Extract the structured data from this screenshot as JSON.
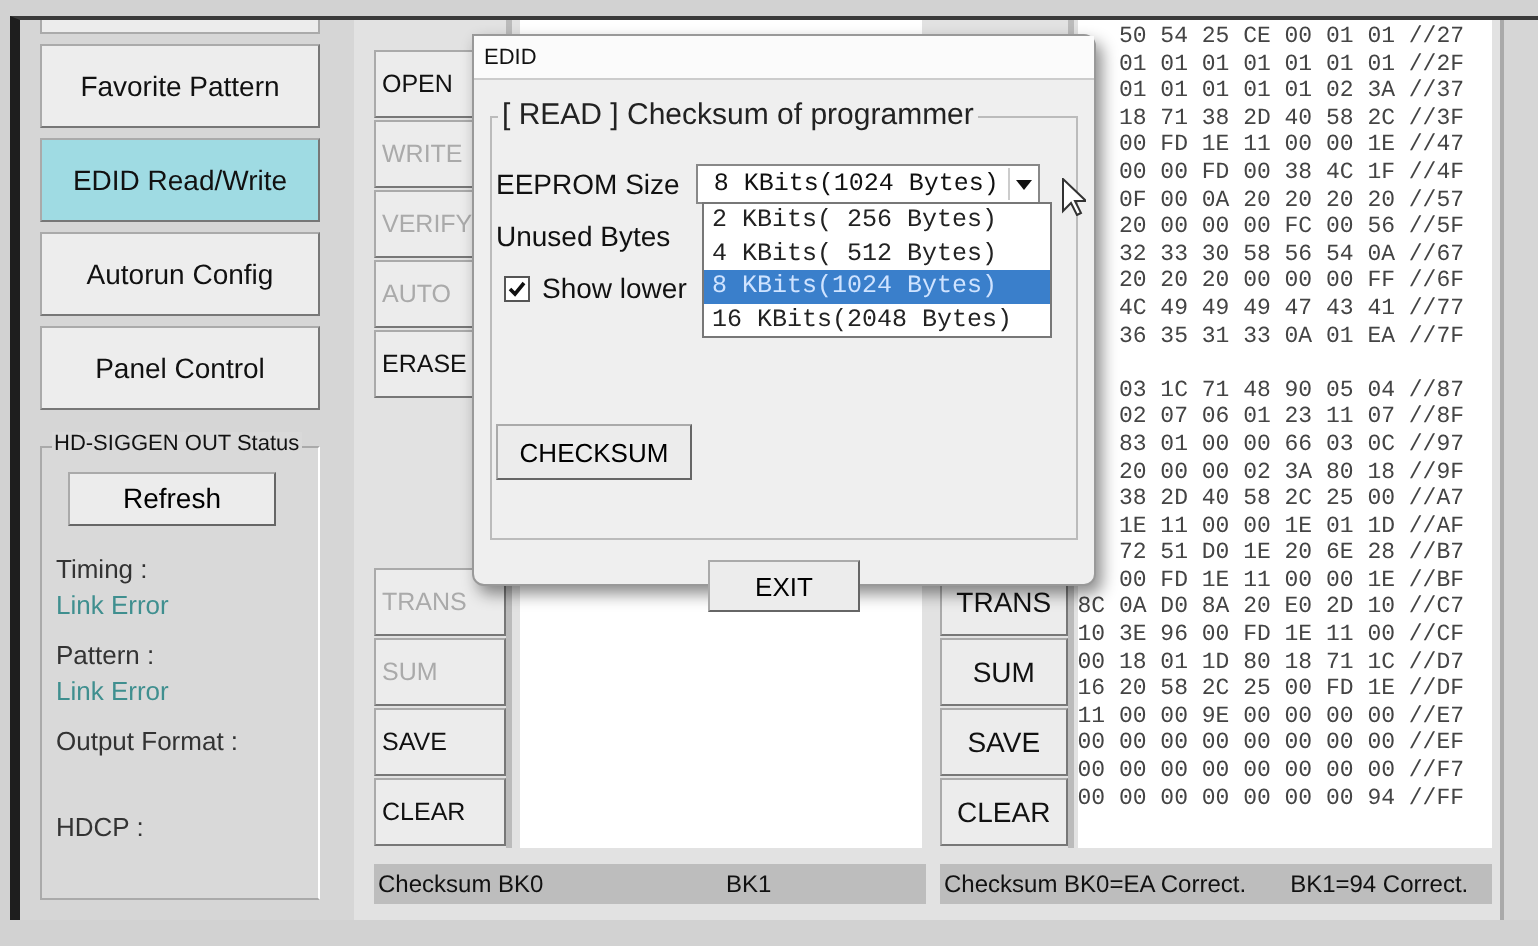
{
  "nav": {
    "items": [
      {
        "label": "Favorite Pattern",
        "selected": false
      },
      {
        "label": "EDID Read/Write",
        "selected": true
      },
      {
        "label": "Autorun Config",
        "selected": false
      },
      {
        "label": "Panel Control",
        "selected": false
      }
    ]
  },
  "status_group": {
    "title": "HD-SIGGEN OUT Status",
    "refresh": "Refresh",
    "fields": [
      {
        "label": "Timing :",
        "value": "Link Error"
      },
      {
        "label": "Pattern :",
        "value": "Link Error"
      },
      {
        "label": "Output Format :"
      },
      {
        "label": "HDCP :"
      }
    ]
  },
  "left_panel": {
    "top_buttons": [
      {
        "label": "OPEN",
        "disabled": false
      },
      {
        "label": "WRITE",
        "disabled": true
      },
      {
        "label": "VERIFY",
        "disabled": true
      },
      {
        "label": "AUTO",
        "disabled": true
      },
      {
        "label": "ERASE",
        "disabled": false
      }
    ],
    "bottom_buttons": [
      {
        "label": "TRANS",
        "disabled": true
      },
      {
        "label": "SUM",
        "disabled": true
      },
      {
        "label": "SAVE",
        "disabled": false
      },
      {
        "label": "CLEAR",
        "disabled": false
      }
    ],
    "status": [
      "Checksum BK0",
      "BK1"
    ]
  },
  "right_panel": {
    "buttons": [
      {
        "label": "TRANS",
        "disabled": false
      },
      {
        "label": "SUM",
        "disabled": false
      },
      {
        "label": "SAVE",
        "disabled": false
      },
      {
        "label": "CLEAR",
        "disabled": false
      }
    ],
    "hex_blocks": [
      [
        "50 54 25 CE 00 01 01 //27",
        "01 01 01 01 01 01 01 //2F",
        "01 01 01 01 01 02 3A //37",
        "18 71 38 2D 40 58 2C //3F",
        "00 FD 1E 11 00 00 1E //47",
        "00 00 FD 00 38 4C 1F //4F",
        "0F 00 0A 20 20 20 20 //57",
        "20 00 00 00 FC 00 56 //5F",
        "32 33 30 58 56 54 0A //67",
        "20 20 20 00 00 00 FF //6F",
        "4C 49 49 49 47 43 41 //77",
        "36 35 31 33 0A 01 EA //7F"
      ],
      [
        "03 1C 71 48 90 05 04 //87",
        "02 07 06 01 23 11 07 //8F",
        "83 01 00 00 66 03 0C //97",
        "20 00 00 02 3A 80 18 //9F",
        "38 2D 40 58 2C 25 00 //A7",
        "1E 11 00 00 1E 01 1D //AF",
        "72 51 D0 1E 20 6E 28 //B7",
        "00 FD 1E 11 00 00 1E //BF",
        "8C 0A D0 8A 20 E0 2D 10 //C7",
        "10 3E 96 00 FD 1E 11 00 //CF",
        "00 18 01 1D 80 18 71 1C //D7",
        "16 20 58 2C 25 00 FD 1E //DF",
        "11 00 00 9E 00 00 00 00 //E7",
        "00 00 00 00 00 00 00 00 //EF",
        "00 00 00 00 00 00 00 00 //F7",
        "00 00 00 00 00 00 00 94 //FF"
      ]
    ],
    "status": [
      "Checksum BK0=EA Correct.",
      "BK1=94 Correct."
    ]
  },
  "dialog": {
    "title": "EDID",
    "group_title": "[ READ ] Checksum of programmer",
    "eeprom_label": "EEPROM Size",
    "eeprom_value": "8 KBits(1024 Bytes)",
    "options": [
      {
        "label": "2 KBits( 256 Bytes)",
        "selected": false
      },
      {
        "label": "4 KBits( 512 Bytes)",
        "selected": false
      },
      {
        "label": "8 KBits(1024 Bytes)",
        "selected": true
      },
      {
        "label": "16 KBits(2048 Bytes)",
        "selected": false
      }
    ],
    "unused_label": "Unused Bytes",
    "show_lower": {
      "label": "Show lower",
      "checked": true
    },
    "checksum_button": "CHECKSUM",
    "exit_button": "EXIT"
  }
}
